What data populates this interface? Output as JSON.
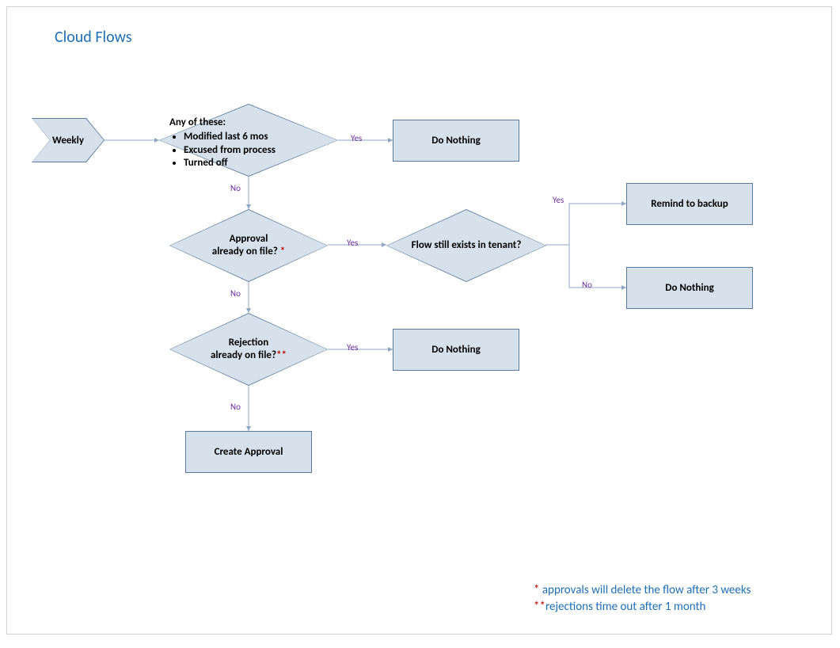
{
  "title": "Cloud Flows",
  "nodes": {
    "start": {
      "label": "Weekly"
    },
    "d1": {
      "heading": "Any of these:",
      "bullets": [
        "Modified last 6 mos",
        "Excused from process",
        "Turned off"
      ]
    },
    "r1": {
      "label": "Do Nothing"
    },
    "d2": {
      "line1": "Approval",
      "line2": "already on file? ",
      "star": "*"
    },
    "d3": {
      "label": "Flow still exists in tenant?"
    },
    "r2": {
      "label": "Remind to backup"
    },
    "r3": {
      "label": "Do Nothing"
    },
    "d4": {
      "line1": "Rejection",
      "line2": "already on file?",
      "star": "**"
    },
    "r4": {
      "label": "Do Nothing"
    },
    "r5": {
      "label": "Create Approval"
    }
  },
  "labels": {
    "yes": "Yes",
    "no": "No"
  },
  "footnotes": {
    "f1_star": "* ",
    "f1_text": "approvals will delete the flow after 3 weeks",
    "f2_star": "**",
    "f2_text": "rejections time out after 1 month"
  },
  "colors": {
    "shapeFill": "#D6E1EC",
    "shapeBorder": "#5B7A99",
    "connector": "#8FA8C2",
    "edgeLabel": "#702FA0",
    "title": "#1F6FB5",
    "red": "#C00000"
  },
  "chart_data": {
    "type": "flowchart",
    "title": "Cloud Flows",
    "nodes": [
      {
        "id": "start",
        "kind": "start-chevron",
        "label": "Weekly"
      },
      {
        "id": "d1",
        "kind": "decision",
        "label": "Any of these: Modified last 6 mos / Excused from process / Turned off"
      },
      {
        "id": "r1",
        "kind": "process",
        "label": "Do Nothing"
      },
      {
        "id": "d2",
        "kind": "decision",
        "label": "Approval already on file? *"
      },
      {
        "id": "d3",
        "kind": "decision",
        "label": "Flow still exists in tenant?"
      },
      {
        "id": "r2",
        "kind": "process",
        "label": "Remind to backup"
      },
      {
        "id": "r3",
        "kind": "process",
        "label": "Do Nothing"
      },
      {
        "id": "d4",
        "kind": "decision",
        "label": "Rejection already on file? **"
      },
      {
        "id": "r4",
        "kind": "process",
        "label": "Do Nothing"
      },
      {
        "id": "r5",
        "kind": "process",
        "label": "Create Approval"
      }
    ],
    "edges": [
      {
        "from": "start",
        "to": "d1",
        "label": ""
      },
      {
        "from": "d1",
        "to": "r1",
        "label": "Yes"
      },
      {
        "from": "d1",
        "to": "d2",
        "label": "No"
      },
      {
        "from": "d2",
        "to": "d3",
        "label": "Yes"
      },
      {
        "from": "d2",
        "to": "d4",
        "label": "No"
      },
      {
        "from": "d3",
        "to": "r2",
        "label": "Yes"
      },
      {
        "from": "d3",
        "to": "r3",
        "label": "No"
      },
      {
        "from": "d4",
        "to": "r4",
        "label": "Yes"
      },
      {
        "from": "d4",
        "to": "r5",
        "label": "No"
      }
    ],
    "footnotes": [
      "* approvals will delete the flow after 3 weeks",
      "** rejections time out after 1 month"
    ]
  }
}
